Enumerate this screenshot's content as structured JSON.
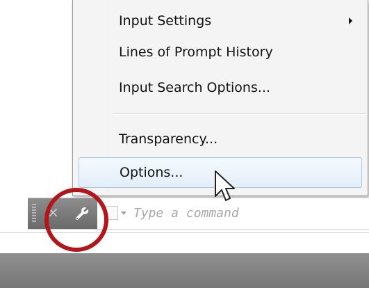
{
  "menu": {
    "items": [
      {
        "label": "Input Settings",
        "has_submenu": true
      },
      {
        "label": "Lines of Prompt History"
      },
      {
        "label": "Input Search Options..."
      },
      {
        "label": "Transparency..."
      },
      {
        "label": "Options...",
        "state": "hovered"
      }
    ]
  },
  "command_line": {
    "placeholder": "Type a command",
    "icons": [
      "grip-handle",
      "close-icon",
      "wrench-icon",
      "recent-commands-icon"
    ]
  },
  "annotation": {
    "ring_color": "#b3161a",
    "highlighted": "wrench-icon"
  },
  "colors": {
    "hover_border": "#a9c7e6",
    "toolbar_gray": "#7a7a7a"
  }
}
